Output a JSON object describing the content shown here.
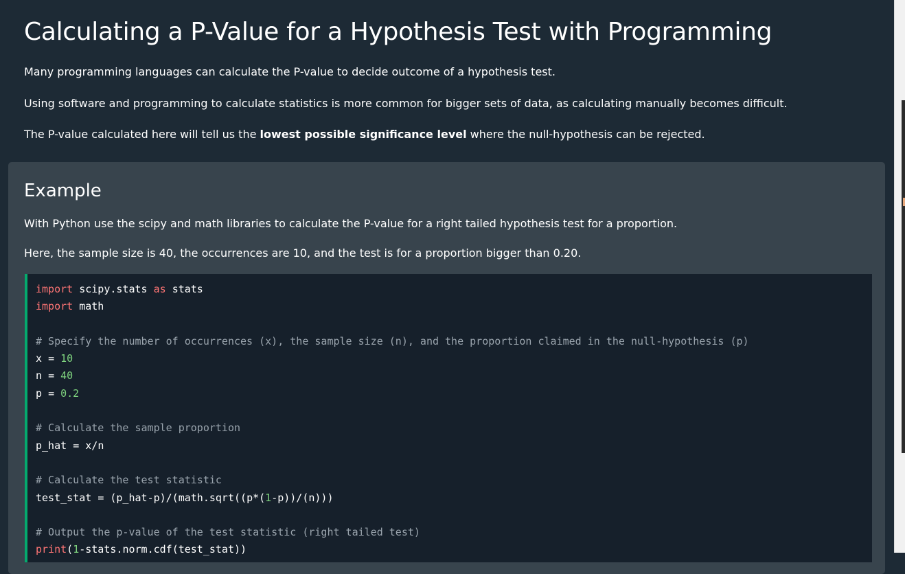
{
  "page": {
    "title": "Calculating a P-Value for a Hypothesis Test with Programming",
    "p1": "Many programming languages can calculate the P-value to decide outcome of a hypothesis test.",
    "p2": "Using software and programming to calculate statistics is more common for bigger sets of data, as calculating manually becomes difficult.",
    "p3_before": "The P-value calculated here will tell us the ",
    "p3_bold": "lowest possible significance level",
    "p3_after": " where the null-hypothesis can be rejected."
  },
  "example": {
    "heading": "Example",
    "p1": "With Python use the scipy and math libraries to calculate the P-value for a right tailed hypothesis test for a proportion.",
    "p2": "Here, the sample size is 40, the occurrences are 10, and the test is for a proportion bigger than 0.20.",
    "code": {
      "language": "python",
      "lines": [
        "import scipy.stats as stats",
        "import math",
        "",
        "# Specify the number of occurrences (x), the sample size (n), and the proportion claimed in the null-hypothesis (p)",
        "x = 10",
        "n = 40",
        "p = 0.2",
        "",
        "# Calculate the sample proportion",
        "p_hat = x/n",
        "",
        "# Calculate the test statistic",
        "test_stat = (p_hat-p)/(math.sqrt((p*(1-p))/(n)))",
        "",
        "# Output the p-value of the test statistic (right tailed test)",
        "print(1-stats.norm.cdf(test_stat))"
      ]
    }
  },
  "colors": {
    "page_background": "#1d2a35",
    "example_background": "#38444d",
    "code_background": "#16202b",
    "code_accent_border": "#04aa6d",
    "keyword": "#ff7575",
    "number": "#7fd47f",
    "comment": "#9aa4ad"
  }
}
